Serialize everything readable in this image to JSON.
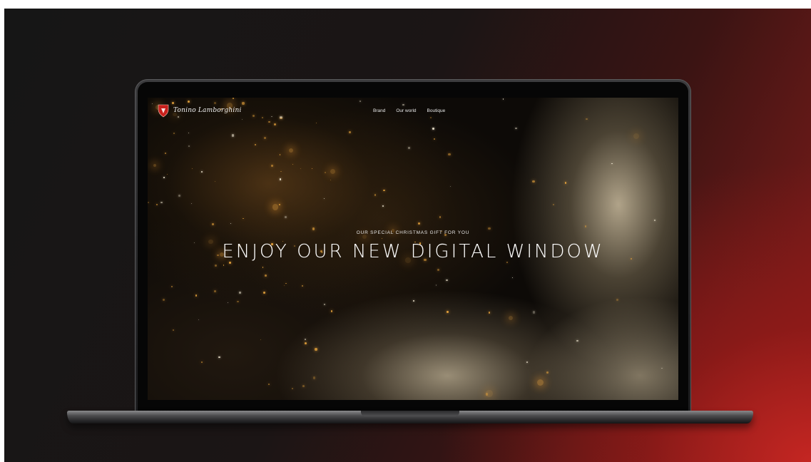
{
  "site": {
    "logo_text": "Tonino Lamborghini",
    "nav": [
      "Brand",
      "Our world",
      "Boutique"
    ]
  },
  "hero": {
    "eyebrow": "OUR SPECIAL CHRISTMAS GIFT FOR YOU",
    "headline": "ENJOY OUR NEW DIGITAL WINDOW"
  },
  "colors": {
    "accent_red": "#c42622",
    "gold_particle": "#e6a33c"
  },
  "icons": {
    "logo": "shield-logo-icon"
  }
}
